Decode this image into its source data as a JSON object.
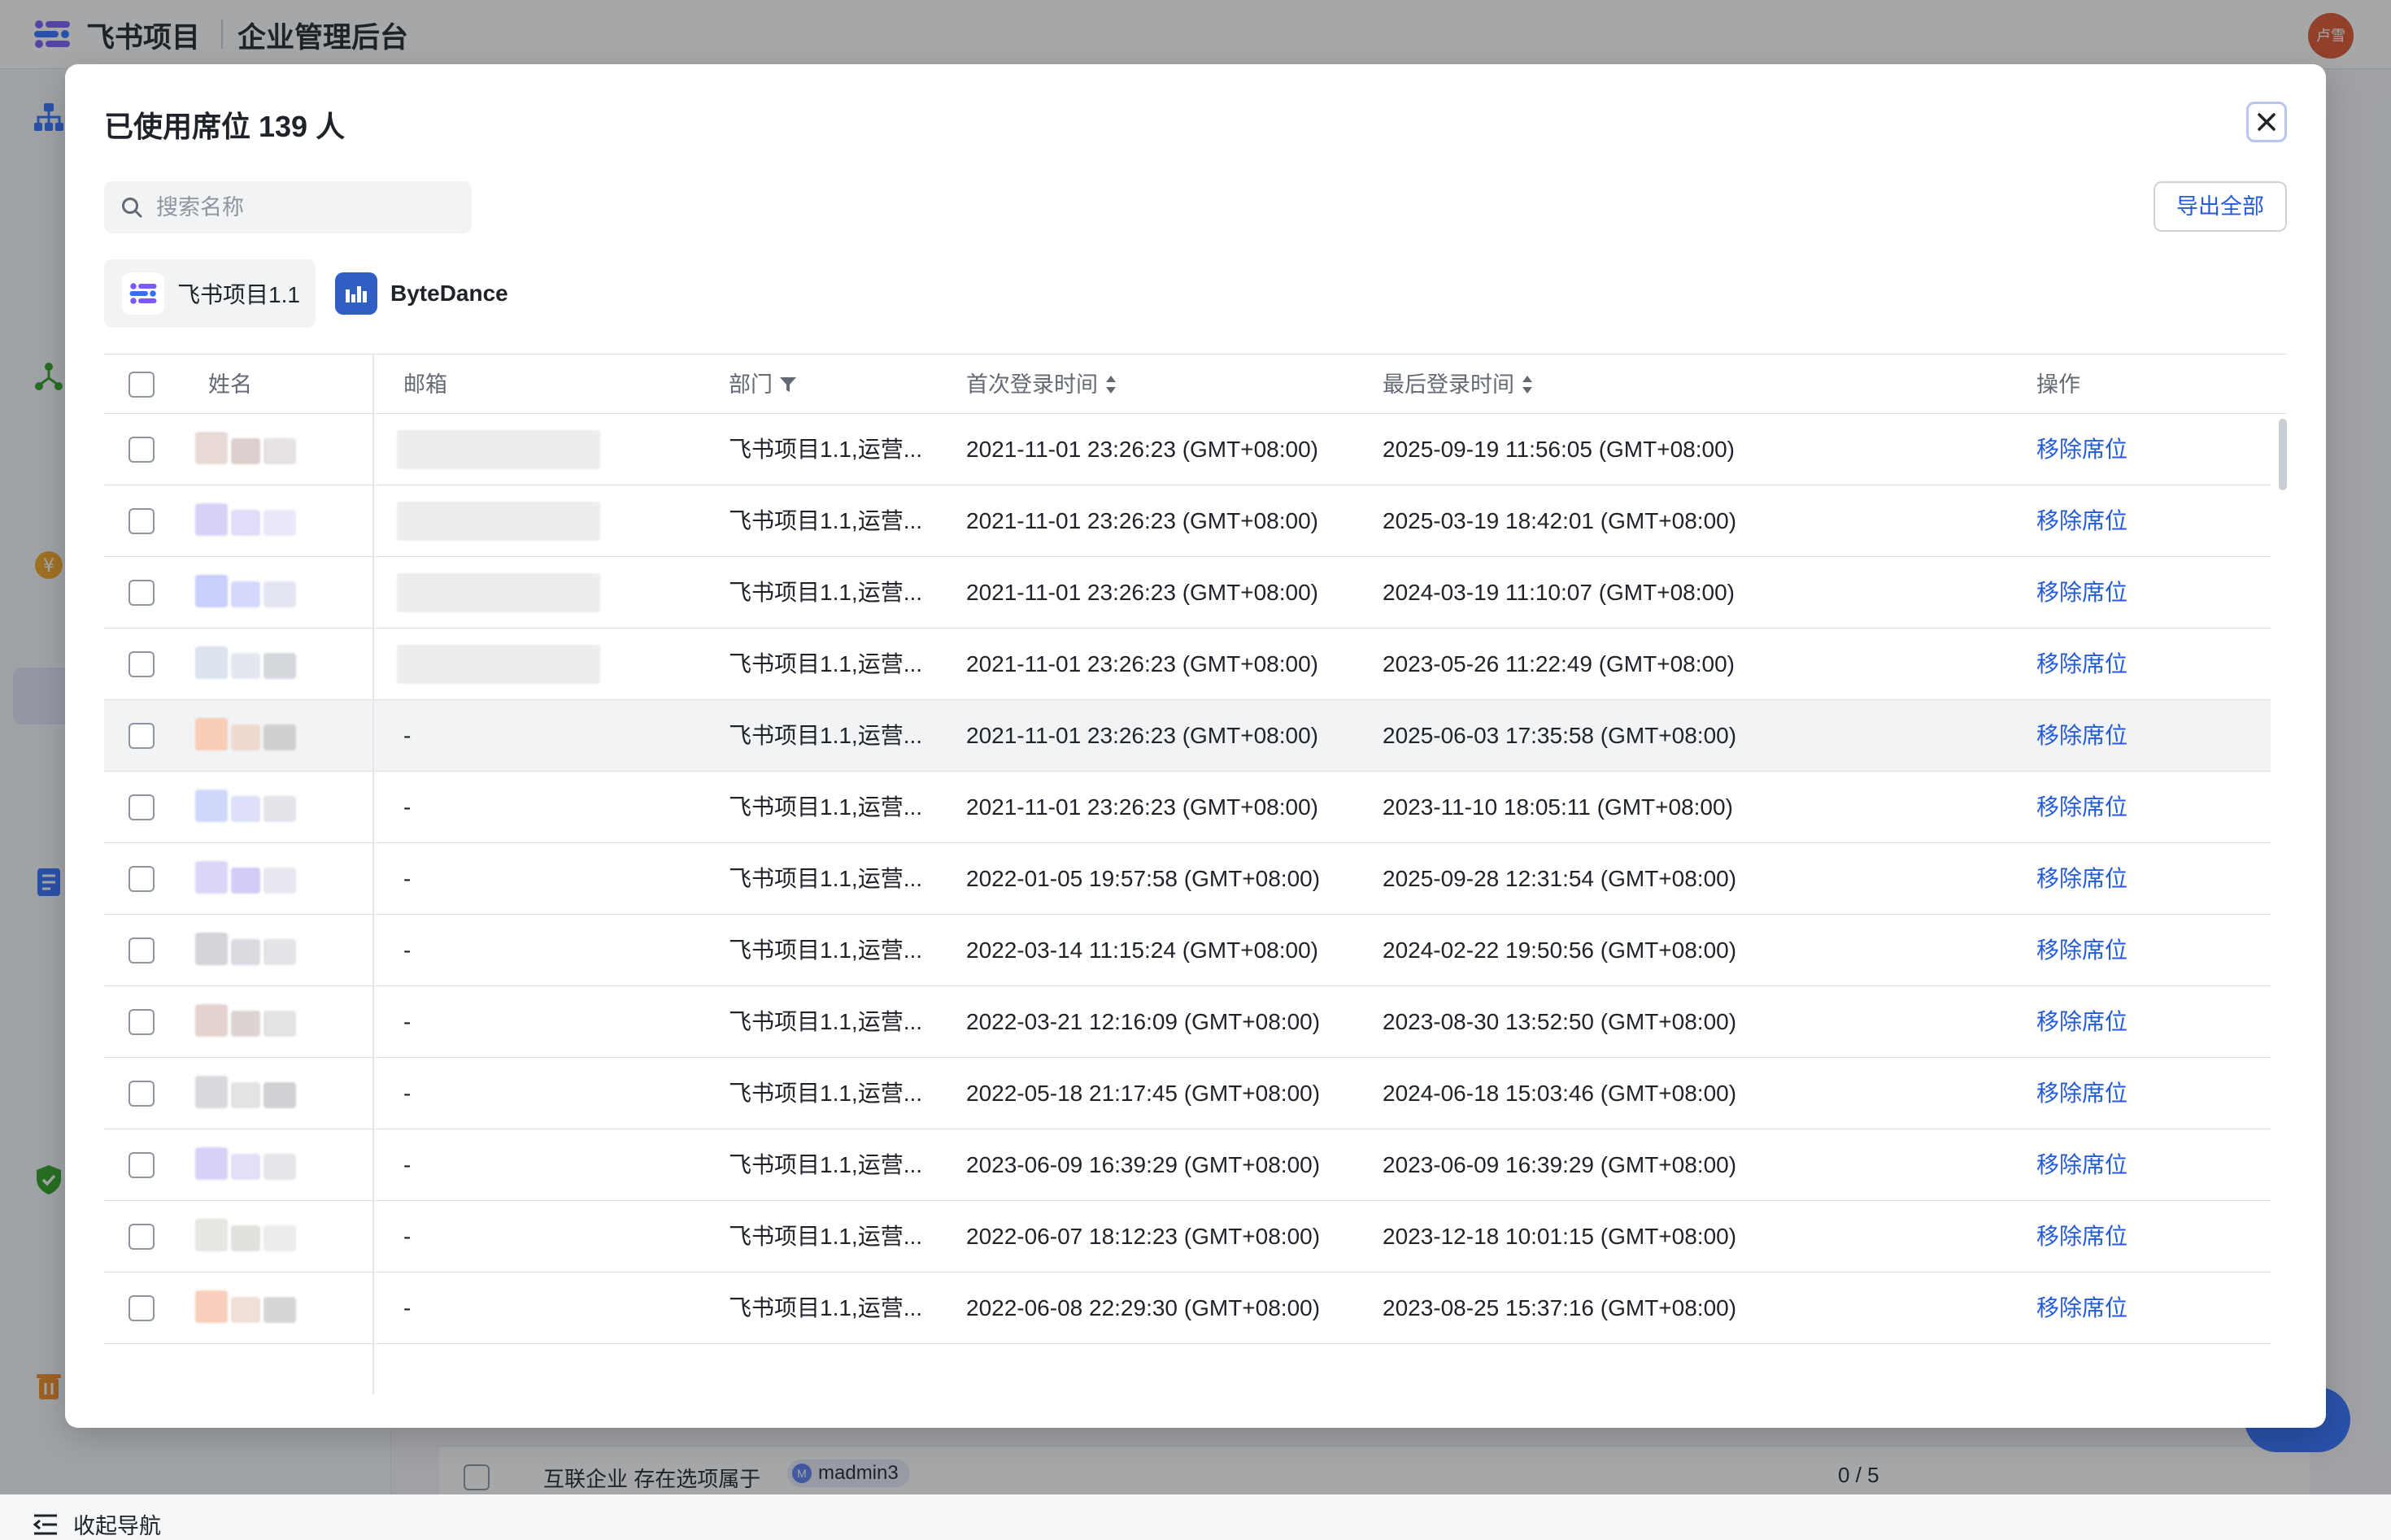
{
  "app": {
    "brand": "飞书项目",
    "subtitle": "企业管理后台",
    "avatar_text": "卢雪",
    "collapse_nav": "收起导航"
  },
  "background_row": {
    "text": "互联企业 存在选项属于",
    "chip": "madmin3",
    "chip_initial": "M",
    "count": "0 / 5"
  },
  "modal": {
    "title": "已使用席位 139 人",
    "search_placeholder": "搜索名称",
    "export_label": "导出全部",
    "tabs": [
      {
        "label": "飞书项目1.1",
        "icon": "feishu-project-icon"
      },
      {
        "label": "ByteDance",
        "icon": "bytedance-icon"
      }
    ],
    "columns": {
      "name": "姓名",
      "email": "邮箱",
      "department": "部门",
      "first_login": "首次登录时间",
      "last_login": "最后登录时间",
      "action": "操作"
    },
    "rows": [
      {
        "email": "",
        "department": "飞书项目1.1,运营...",
        "first_login": "2021-11-01 23:26:23 (GMT+08:00)",
        "last_login": "2025-09-19 11:56:05 (GMT+08:00)",
        "action": "移除席位"
      },
      {
        "email": "",
        "department": "飞书项目1.1,运营...",
        "first_login": "2021-11-01 23:26:23 (GMT+08:00)",
        "last_login": "2025-03-19 18:42:01 (GMT+08:00)",
        "action": "移除席位"
      },
      {
        "email": "",
        "department": "飞书项目1.1,运营...",
        "first_login": "2021-11-01 23:26:23 (GMT+08:00)",
        "last_login": "2024-03-19 11:10:07 (GMT+08:00)",
        "action": "移除席位"
      },
      {
        "email": "",
        "department": "飞书项目1.1,运营...",
        "first_login": "2021-11-01 23:26:23 (GMT+08:00)",
        "last_login": "2023-05-26 11:22:49 (GMT+08:00)",
        "action": "移除席位"
      },
      {
        "email": "-",
        "department": "飞书项目1.1,运营...",
        "first_login": "2021-11-01 23:26:23 (GMT+08:00)",
        "last_login": "2025-06-03 17:35:58 (GMT+08:00)",
        "action": "移除席位"
      },
      {
        "email": "-",
        "department": "飞书项目1.1,运营...",
        "first_login": "2021-11-01 23:26:23 (GMT+08:00)",
        "last_login": "2023-11-10 18:05:11 (GMT+08:00)",
        "action": "移除席位"
      },
      {
        "email": "-",
        "department": "飞书项目1.1,运营...",
        "first_login": "2022-01-05 19:57:58 (GMT+08:00)",
        "last_login": "2025-09-28 12:31:54 (GMT+08:00)",
        "action": "移除席位"
      },
      {
        "email": "-",
        "department": "飞书项目1.1,运营...",
        "first_login": "2022-03-14 11:15:24 (GMT+08:00)",
        "last_login": "2024-02-22 19:50:56 (GMT+08:00)",
        "action": "移除席位"
      },
      {
        "email": "-",
        "department": "飞书项目1.1,运营...",
        "first_login": "2022-03-21 12:16:09 (GMT+08:00)",
        "last_login": "2023-08-30 13:52:50 (GMT+08:00)",
        "action": "移除席位"
      },
      {
        "email": "-",
        "department": "飞书项目1.1,运营...",
        "first_login": "2022-05-18 21:17:45 (GMT+08:00)",
        "last_login": "2024-06-18 15:03:46 (GMT+08:00)",
        "action": "移除席位"
      },
      {
        "email": "-",
        "department": "飞书项目1.1,运营...",
        "first_login": "2023-06-09 16:39:29 (GMT+08:00)",
        "last_login": "2023-06-09 16:39:29 (GMT+08:00)",
        "action": "移除席位"
      },
      {
        "email": "-",
        "department": "飞书项目1.1,运营...",
        "first_login": "2022-06-07 18:12:23 (GMT+08:00)",
        "last_login": "2023-12-18 10:01:15 (GMT+08:00)",
        "action": "移除席位"
      },
      {
        "email": "-",
        "department": "飞书项目1.1,运营...",
        "first_login": "2022-06-08 22:29:30 (GMT+08:00)",
        "last_login": "2023-08-25 15:37:16 (GMT+08:00)",
        "action": "移除席位"
      }
    ],
    "highlighted_row": 4
  },
  "colors": {
    "accent": "#245bdb",
    "brand": "#3370ff",
    "avatar": "#e0542c"
  }
}
